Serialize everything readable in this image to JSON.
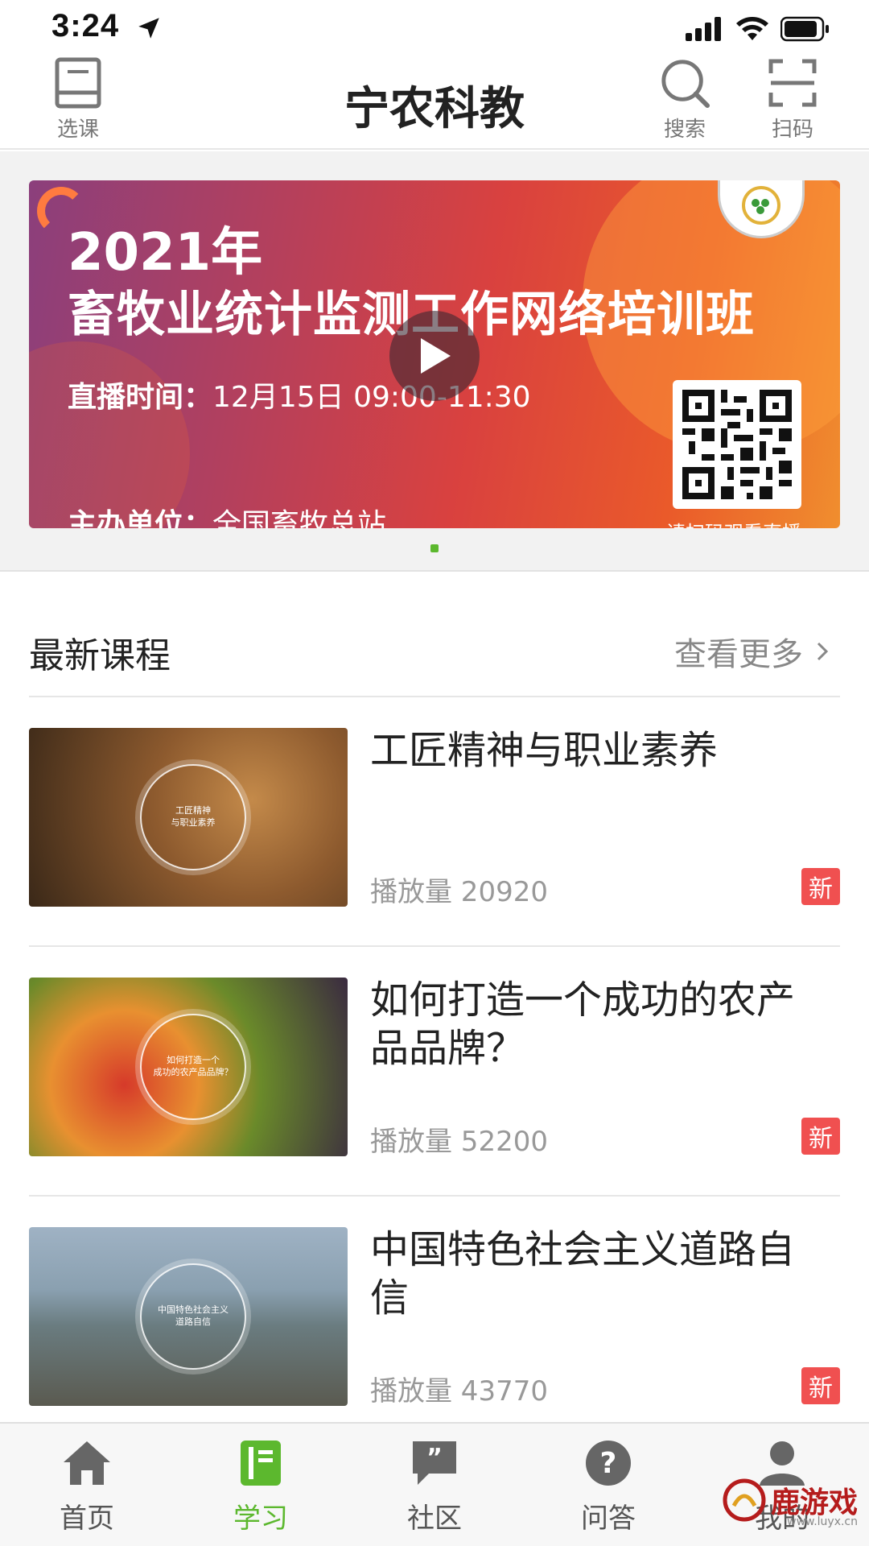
{
  "status_bar": {
    "time": "3:24"
  },
  "header": {
    "title": "宁农科教",
    "left_button": {
      "label": "选课",
      "icon": "book-icon"
    },
    "search_button": {
      "label": "搜索",
      "icon": "search-icon"
    },
    "scan_button": {
      "label": "扫码",
      "icon": "scan-icon"
    }
  },
  "banner": {
    "year": "2021年",
    "title": "畜牧业统计监测工作网络培训班",
    "time_label": "直播时间：",
    "time_value": "12月15日 09:00-11:30",
    "org_label": "主办单位：",
    "org_value": "全国畜牧总站",
    "qr_caption": "请扫码观看直播",
    "play_icon": "play-icon",
    "carousel_active_index": 0,
    "carousel_count": 1
  },
  "latest": {
    "title": "最新课程",
    "more_label": "查看更多"
  },
  "courses": [
    {
      "title": "工匠精神与职业素养",
      "thumb_text": "工匠精神\n与职业素养",
      "plays": "播放量 20920",
      "badge": "新"
    },
    {
      "title": "如何打造一个成功的农产品品牌？",
      "thumb_text": "如何打造一个\n成功的农产品品牌？",
      "plays": "播放量 52200",
      "badge": "新"
    },
    {
      "title": "中国特色社会主义道路自信",
      "thumb_text": "中国特色社会主义\n道路自信",
      "plays": "播放量 43770",
      "badge": "新"
    }
  ],
  "tabbar": {
    "items": [
      {
        "label": "首页",
        "icon": "home-icon"
      },
      {
        "label": "学习",
        "icon": "study-icon",
        "active": true
      },
      {
        "label": "社区",
        "icon": "community-icon"
      },
      {
        "label": "问答",
        "icon": "question-icon"
      },
      {
        "label": "我的",
        "icon": "profile-icon"
      }
    ]
  },
  "colors": {
    "accent": "#5cb82e",
    "badge": "#f05050"
  },
  "watermark": {
    "text": "鹿游戏",
    "url": "www.luyx.cn"
  }
}
